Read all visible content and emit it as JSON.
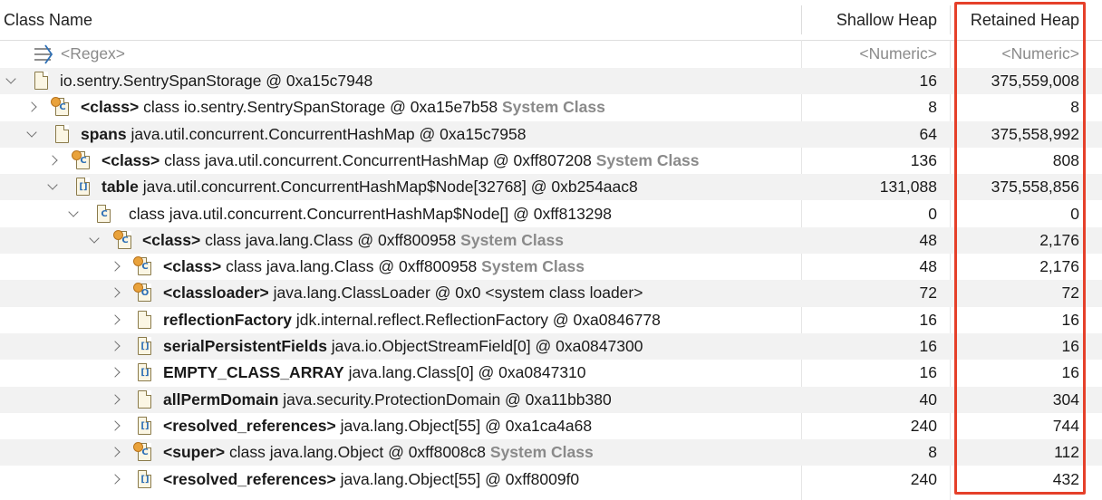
{
  "columns": {
    "class_name": "Class Name",
    "shallow_heap": "Shallow Heap",
    "retained_heap": "Retained Heap"
  },
  "filter_row": {
    "name_placeholder": "<Regex>",
    "shallow_placeholder": "<Numeric>",
    "retained_placeholder": "<Numeric>"
  },
  "rows": [
    {
      "bold": "",
      "text": "io.sentry.SentrySpanStorage @ 0xa15c7948",
      "sys": "",
      "shallow": "16",
      "retained": "375,559,008",
      "icon": "object-icon"
    },
    {
      "bold": "<class>",
      "text": "class io.sentry.SentrySpanStorage @ 0xa15e7b58",
      "sys": "System Class",
      "shallow": "8",
      "retained": "8",
      "icon": "class-icon"
    },
    {
      "bold": "spans",
      "text": "java.util.concurrent.ConcurrentHashMap @ 0xa15c7958",
      "sys": "",
      "shallow": "64",
      "retained": "375,558,992",
      "icon": "object-icon"
    },
    {
      "bold": "<class>",
      "text": "class java.util.concurrent.ConcurrentHashMap @ 0xff807208",
      "sys": "System Class",
      "shallow": "136",
      "retained": "808",
      "icon": "class-icon"
    },
    {
      "bold": "table",
      "text": "java.util.concurrent.ConcurrentHashMap$Node[32768] @ 0xb254aac8",
      "sys": "",
      "shallow": "131,088",
      "retained": "375,558,856",
      "icon": "array-icon"
    },
    {
      "bold": "",
      "text": "class java.util.concurrent.ConcurrentHashMap$Node[] @ 0xff813298",
      "sys": "",
      "shallow": "0",
      "retained": "0",
      "icon": "class-icon"
    },
    {
      "bold": "<class>",
      "text": "class java.lang.Class @ 0xff800958",
      "sys": "System Class",
      "shallow": "48",
      "retained": "2,176",
      "icon": "class-icon"
    },
    {
      "bold": "<class>",
      "text": "class java.lang.Class @ 0xff800958",
      "sys": "System Class",
      "shallow": "48",
      "retained": "2,176",
      "icon": "class-icon"
    },
    {
      "bold": "<classloader>",
      "text": "java.lang.ClassLoader @ 0x0  <system class loader>",
      "sys": "",
      "shallow": "72",
      "retained": "72",
      "icon": "classloader-icon"
    },
    {
      "bold": "reflectionFactory",
      "text": "jdk.internal.reflect.ReflectionFactory @ 0xa0846778",
      "sys": "",
      "shallow": "16",
      "retained": "16",
      "icon": "object-icon"
    },
    {
      "bold": "serialPersistentFields",
      "text": "java.io.ObjectStreamField[0] @ 0xa0847300",
      "sys": "",
      "shallow": "16",
      "retained": "16",
      "icon": "array-icon"
    },
    {
      "bold": "EMPTY_CLASS_ARRAY",
      "text": "java.lang.Class[0] @ 0xa0847310",
      "sys": "",
      "shallow": "16",
      "retained": "16",
      "icon": "array-icon"
    },
    {
      "bold": "allPermDomain",
      "text": "java.security.ProtectionDomain @ 0xa11bb380",
      "sys": "",
      "shallow": "40",
      "retained": "304",
      "icon": "object-icon"
    },
    {
      "bold": "<resolved_references>",
      "text": "java.lang.Object[55] @ 0xa1ca4a68",
      "sys": "",
      "shallow": "240",
      "retained": "744",
      "icon": "array-icon"
    },
    {
      "bold": "<super>",
      "text": "class java.lang.Object @ 0xff8008c8",
      "sys": "System Class",
      "shallow": "8",
      "retained": "112",
      "icon": "class-icon"
    },
    {
      "bold": "<resolved_references>",
      "text": "java.lang.Object[55] @ 0xff8009f0",
      "sys": "",
      "shallow": "240",
      "retained": "432",
      "icon": "array-icon"
    }
  ]
}
